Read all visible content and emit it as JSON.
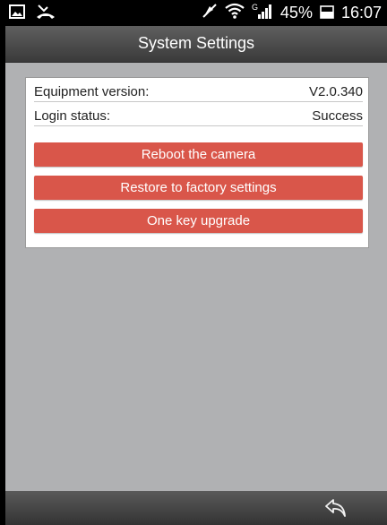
{
  "status_bar": {
    "battery_percent": "45%",
    "time": "16:07",
    "signal_label": "G",
    "icons": [
      "image-icon",
      "missed-call-icon",
      "mute-icon",
      "wifi-icon",
      "signal-icon",
      "battery-icon"
    ]
  },
  "header": {
    "title": "System Settings"
  },
  "info": {
    "equipment_version_label": "Equipment version:",
    "equipment_version_value": "V2.0.340",
    "login_status_label": "Login status:",
    "login_status_value": "Success"
  },
  "actions": {
    "reboot_label": "Reboot the camera",
    "restore_label": "Restore to factory settings",
    "upgrade_label": "One key upgrade"
  },
  "footer": {
    "back_icon": "back-arrow-icon"
  },
  "colors": {
    "button": "#d9564a",
    "background": "#b0b1b3",
    "appbar": "#4a4a4a"
  }
}
